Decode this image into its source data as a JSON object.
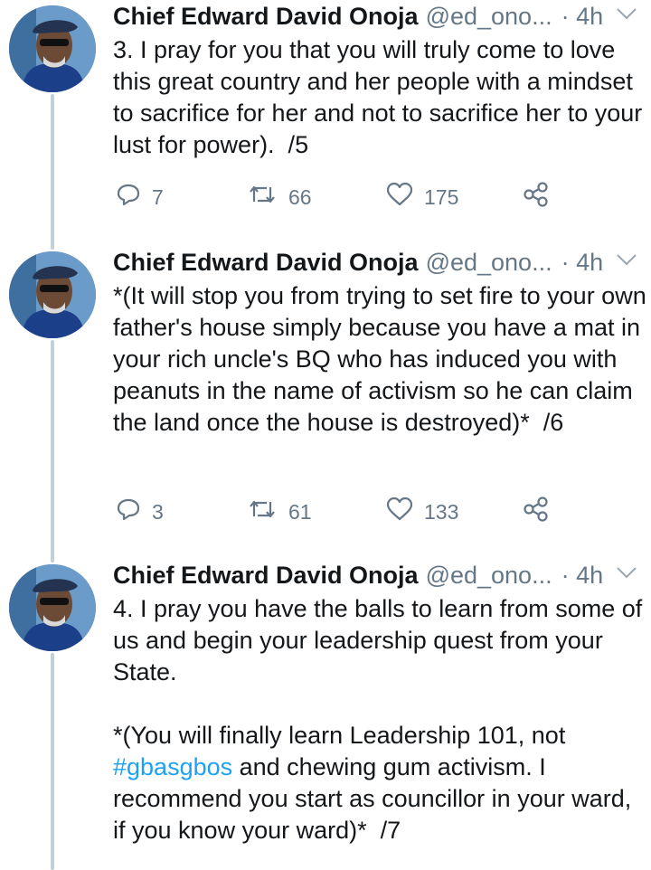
{
  "tweets": [
    {
      "name": "Chief Edward David Onoja",
      "handle": "@ed_ono...",
      "time": "· 4h",
      "text": "3. I pray for you that you will truly come to love this great country and her people with a mindset to sacrifice for her and not to sacrifice her to your lust for power).  /5",
      "replies": "7",
      "retweets": "66",
      "likes": "175"
    },
    {
      "name": "Chief Edward David Onoja",
      "handle": "@ed_ono...",
      "time": "· 4h",
      "text": "*(It will stop you from trying to set fire to your own father's house simply because you have a mat in your rich uncle's BQ who has induced you with peanuts in the name of activism so he can claim the land once the house is destroyed)*  /6",
      "replies": "3",
      "retweets": "61",
      "likes": "133"
    },
    {
      "name": "Chief Edward David Onoja",
      "handle": "@ed_ono...",
      "time": "· 4h",
      "text_part1": "4. I pray you have the balls to learn from some of us and begin your leadership quest from your State.\n\n*(You will finally learn Leadership 101, not ",
      "hashtag": "#gbasgbos",
      "text_part2": " and chewing gum activism. I recommend you start as councillor in your ward, if you know your ward)*  /7"
    }
  ],
  "colors": {
    "text": "#14171a",
    "secondary": "#657786",
    "link": "#1da1f2",
    "thread_line": "#c4cfd6"
  },
  "icons": [
    "reply-icon",
    "retweet-icon",
    "like-icon",
    "share-icon",
    "chevron-down-icon"
  ]
}
